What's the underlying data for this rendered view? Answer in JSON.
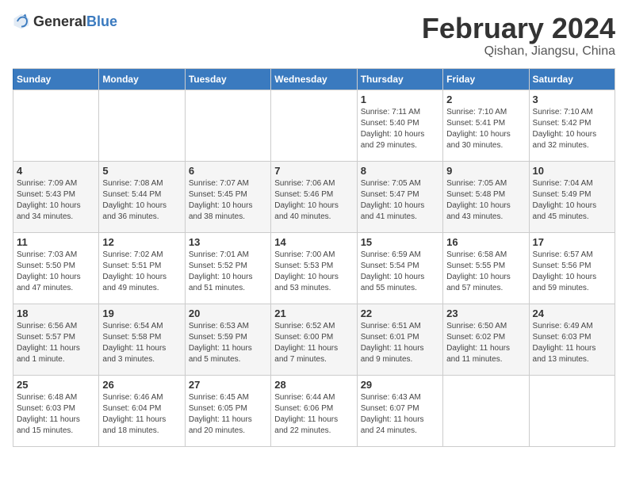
{
  "header": {
    "logo_general": "General",
    "logo_blue": "Blue",
    "month_year": "February 2024",
    "location": "Qishan, Jiangsu, China"
  },
  "days_of_week": [
    "Sunday",
    "Monday",
    "Tuesday",
    "Wednesday",
    "Thursday",
    "Friday",
    "Saturday"
  ],
  "weeks": [
    [
      {
        "day": "",
        "info": ""
      },
      {
        "day": "",
        "info": ""
      },
      {
        "day": "",
        "info": ""
      },
      {
        "day": "",
        "info": ""
      },
      {
        "day": "1",
        "info": "Sunrise: 7:11 AM\nSunset: 5:40 PM\nDaylight: 10 hours\nand 29 minutes."
      },
      {
        "day": "2",
        "info": "Sunrise: 7:10 AM\nSunset: 5:41 PM\nDaylight: 10 hours\nand 30 minutes."
      },
      {
        "day": "3",
        "info": "Sunrise: 7:10 AM\nSunset: 5:42 PM\nDaylight: 10 hours\nand 32 minutes."
      }
    ],
    [
      {
        "day": "4",
        "info": "Sunrise: 7:09 AM\nSunset: 5:43 PM\nDaylight: 10 hours\nand 34 minutes."
      },
      {
        "day": "5",
        "info": "Sunrise: 7:08 AM\nSunset: 5:44 PM\nDaylight: 10 hours\nand 36 minutes."
      },
      {
        "day": "6",
        "info": "Sunrise: 7:07 AM\nSunset: 5:45 PM\nDaylight: 10 hours\nand 38 minutes."
      },
      {
        "day": "7",
        "info": "Sunrise: 7:06 AM\nSunset: 5:46 PM\nDaylight: 10 hours\nand 40 minutes."
      },
      {
        "day": "8",
        "info": "Sunrise: 7:05 AM\nSunset: 5:47 PM\nDaylight: 10 hours\nand 41 minutes."
      },
      {
        "day": "9",
        "info": "Sunrise: 7:05 AM\nSunset: 5:48 PM\nDaylight: 10 hours\nand 43 minutes."
      },
      {
        "day": "10",
        "info": "Sunrise: 7:04 AM\nSunset: 5:49 PM\nDaylight: 10 hours\nand 45 minutes."
      }
    ],
    [
      {
        "day": "11",
        "info": "Sunrise: 7:03 AM\nSunset: 5:50 PM\nDaylight: 10 hours\nand 47 minutes."
      },
      {
        "day": "12",
        "info": "Sunrise: 7:02 AM\nSunset: 5:51 PM\nDaylight: 10 hours\nand 49 minutes."
      },
      {
        "day": "13",
        "info": "Sunrise: 7:01 AM\nSunset: 5:52 PM\nDaylight: 10 hours\nand 51 minutes."
      },
      {
        "day": "14",
        "info": "Sunrise: 7:00 AM\nSunset: 5:53 PM\nDaylight: 10 hours\nand 53 minutes."
      },
      {
        "day": "15",
        "info": "Sunrise: 6:59 AM\nSunset: 5:54 PM\nDaylight: 10 hours\nand 55 minutes."
      },
      {
        "day": "16",
        "info": "Sunrise: 6:58 AM\nSunset: 5:55 PM\nDaylight: 10 hours\nand 57 minutes."
      },
      {
        "day": "17",
        "info": "Sunrise: 6:57 AM\nSunset: 5:56 PM\nDaylight: 10 hours\nand 59 minutes."
      }
    ],
    [
      {
        "day": "18",
        "info": "Sunrise: 6:56 AM\nSunset: 5:57 PM\nDaylight: 11 hours\nand 1 minute."
      },
      {
        "day": "19",
        "info": "Sunrise: 6:54 AM\nSunset: 5:58 PM\nDaylight: 11 hours\nand 3 minutes."
      },
      {
        "day": "20",
        "info": "Sunrise: 6:53 AM\nSunset: 5:59 PM\nDaylight: 11 hours\nand 5 minutes."
      },
      {
        "day": "21",
        "info": "Sunrise: 6:52 AM\nSunset: 6:00 PM\nDaylight: 11 hours\nand 7 minutes."
      },
      {
        "day": "22",
        "info": "Sunrise: 6:51 AM\nSunset: 6:01 PM\nDaylight: 11 hours\nand 9 minutes."
      },
      {
        "day": "23",
        "info": "Sunrise: 6:50 AM\nSunset: 6:02 PM\nDaylight: 11 hours\nand 11 minutes."
      },
      {
        "day": "24",
        "info": "Sunrise: 6:49 AM\nSunset: 6:03 PM\nDaylight: 11 hours\nand 13 minutes."
      }
    ],
    [
      {
        "day": "25",
        "info": "Sunrise: 6:48 AM\nSunset: 6:03 PM\nDaylight: 11 hours\nand 15 minutes."
      },
      {
        "day": "26",
        "info": "Sunrise: 6:46 AM\nSunset: 6:04 PM\nDaylight: 11 hours\nand 18 minutes."
      },
      {
        "day": "27",
        "info": "Sunrise: 6:45 AM\nSunset: 6:05 PM\nDaylight: 11 hours\nand 20 minutes."
      },
      {
        "day": "28",
        "info": "Sunrise: 6:44 AM\nSunset: 6:06 PM\nDaylight: 11 hours\nand 22 minutes."
      },
      {
        "day": "29",
        "info": "Sunrise: 6:43 AM\nSunset: 6:07 PM\nDaylight: 11 hours\nand 24 minutes."
      },
      {
        "day": "",
        "info": ""
      },
      {
        "day": "",
        "info": ""
      }
    ]
  ]
}
